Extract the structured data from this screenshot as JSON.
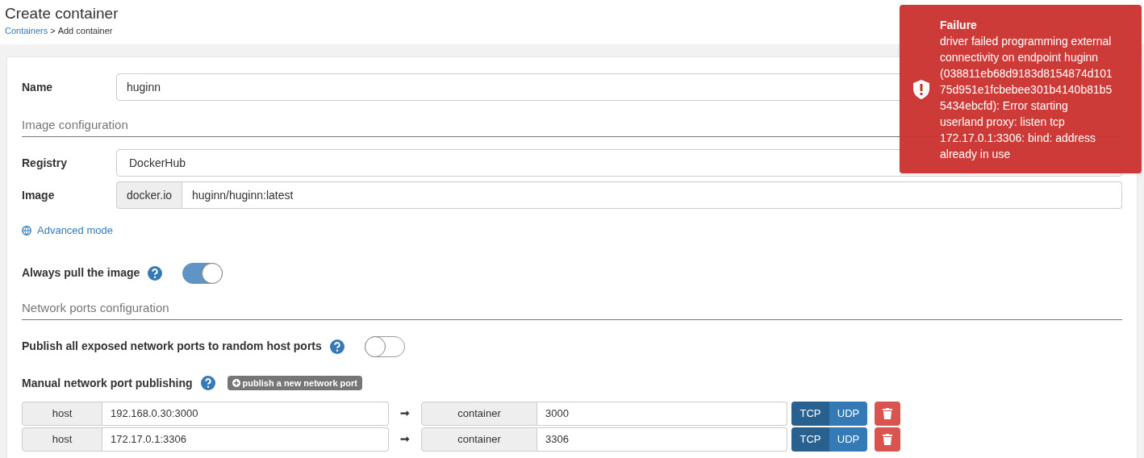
{
  "header": {
    "title": "Create container",
    "breadcrumb": {
      "link": "Containers",
      "separator": ">",
      "current": "Add container"
    }
  },
  "form": {
    "name": {
      "label": "Name",
      "value": "huginn"
    },
    "image_section": "Image configuration",
    "registry": {
      "label": "Registry",
      "value": "DockerHub"
    },
    "image": {
      "label": "Image",
      "prefix": "docker.io",
      "value": "huginn/huginn:latest"
    },
    "advanced_mode": "Advanced mode",
    "always_pull": {
      "label": "Always pull the image",
      "on": true
    },
    "network_section": "Network ports configuration",
    "publish_all": {
      "label": "Publish all exposed network ports to random host ports",
      "on": false
    },
    "manual": {
      "label": "Manual network port publishing",
      "add_button": "publish a new network port"
    },
    "ports": [
      {
        "host_label": "host",
        "host": "192.168.0.30:3000",
        "arrow": "➞",
        "container_label": "container",
        "container": "3000",
        "protocols": [
          {
            "label": "TCP",
            "selected": true
          },
          {
            "label": "UDP",
            "selected": false
          }
        ]
      },
      {
        "host_label": "host",
        "host": "172.17.0.1:3306",
        "arrow": "➞",
        "container_label": "container",
        "container": "3306",
        "protocols": [
          {
            "label": "TCP",
            "selected": true
          },
          {
            "label": "UDP",
            "selected": false
          }
        ]
      }
    ]
  },
  "toast": {
    "title": "Failure",
    "message": "driver failed programming external connectivity on endpoint huginn (038811eb68d9183d8154874d10175d951e1fcbebee301b4140b81b55434ebcfd): Error starting userland proxy: listen tcp 172.17.0.1:3306: bind: address already in use"
  }
}
